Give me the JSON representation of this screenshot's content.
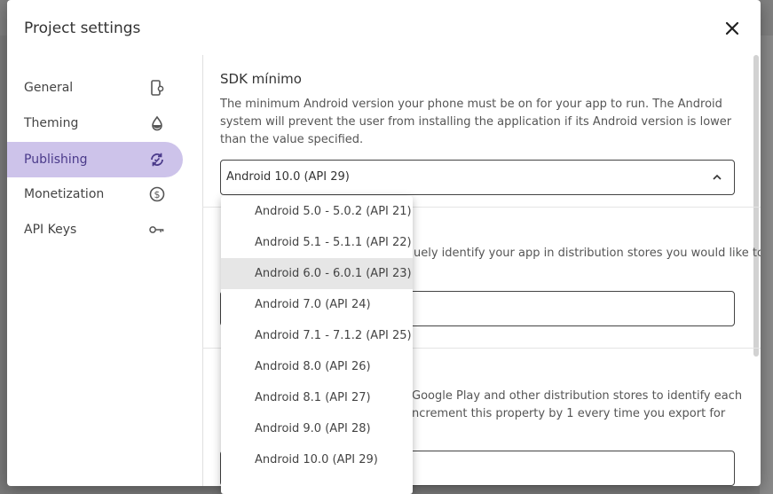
{
  "dialog": {
    "title": "Project settings"
  },
  "sidebar": {
    "items": [
      {
        "label": "General",
        "icon": "app-settings-icon",
        "active": false
      },
      {
        "label": "Theming",
        "icon": "drop-icon",
        "active": false
      },
      {
        "label": "Publishing",
        "icon": "sync-icon",
        "active": true
      },
      {
        "label": "Monetization",
        "icon": "dollar-icon",
        "active": false
      },
      {
        "label": "API Keys",
        "icon": "key-icon",
        "active": false
      }
    ]
  },
  "content": {
    "min_sdk_title": "SDK mínimo",
    "min_sdk_description": "The minimum Android version your phone must be on for your app to run. The Android system will prevent the user from installing the application if its Android version is lower than the value specified.",
    "min_sdk_value": "Android 10.0 (API 29)",
    "package_description_fragment": "uely identify your app in distribution stores you would like to",
    "version_description_line1": "Google Play and other distribution stores to identify each",
    "version_description_line2": "ncrement this property by 1 every time you export for"
  },
  "dropdown": {
    "options": [
      "Android 5.0 - 5.0.2 (API 21)",
      "Android 5.1 - 5.1.1 (API 22)",
      "Android 6.0 - 6.0.1 (API 23)",
      "Android 7.0 (API 24)",
      "Android 7.1 - 7.1.2 (API 25)",
      "Android 8.0 (API 26)",
      "Android 8.1 (API 27)",
      "Android 9.0 (API 28)",
      "Android 10.0 (API 29)"
    ],
    "hovered": "Android 6.0 - 6.0.1 (API 23)"
  },
  "colors": {
    "accent_bg": "#cdc3ea",
    "accent_fg": "#4a3a8a"
  }
}
